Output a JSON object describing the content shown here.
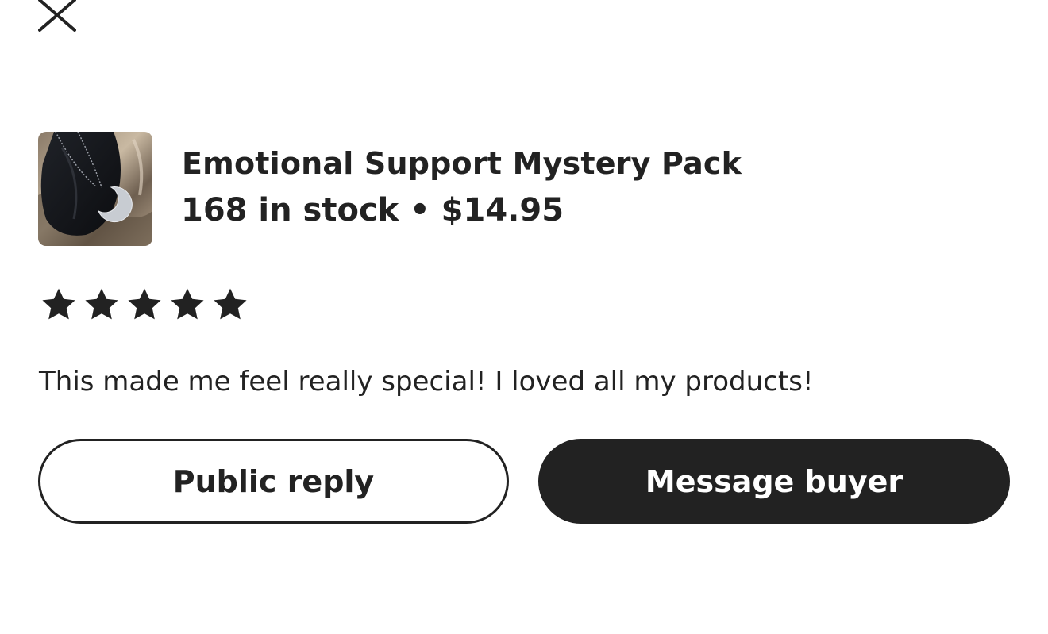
{
  "header": {
    "close_icon": "close-icon"
  },
  "product": {
    "title": "Emotional Support Mystery Pack",
    "meta": "168 in stock • $14.95",
    "thumbnail_description": "crescent-moon-necklace-image"
  },
  "review": {
    "rating": 5,
    "rating_max": 5,
    "text": "This made me feel really special! I loved all my products!"
  },
  "actions": {
    "public_reply_label": "Public reply",
    "message_buyer_label": "Message buyer"
  },
  "colors": {
    "text": "#222222",
    "primary_button_bg": "#222222",
    "primary_button_text": "#ffffff",
    "background": "#ffffff"
  }
}
